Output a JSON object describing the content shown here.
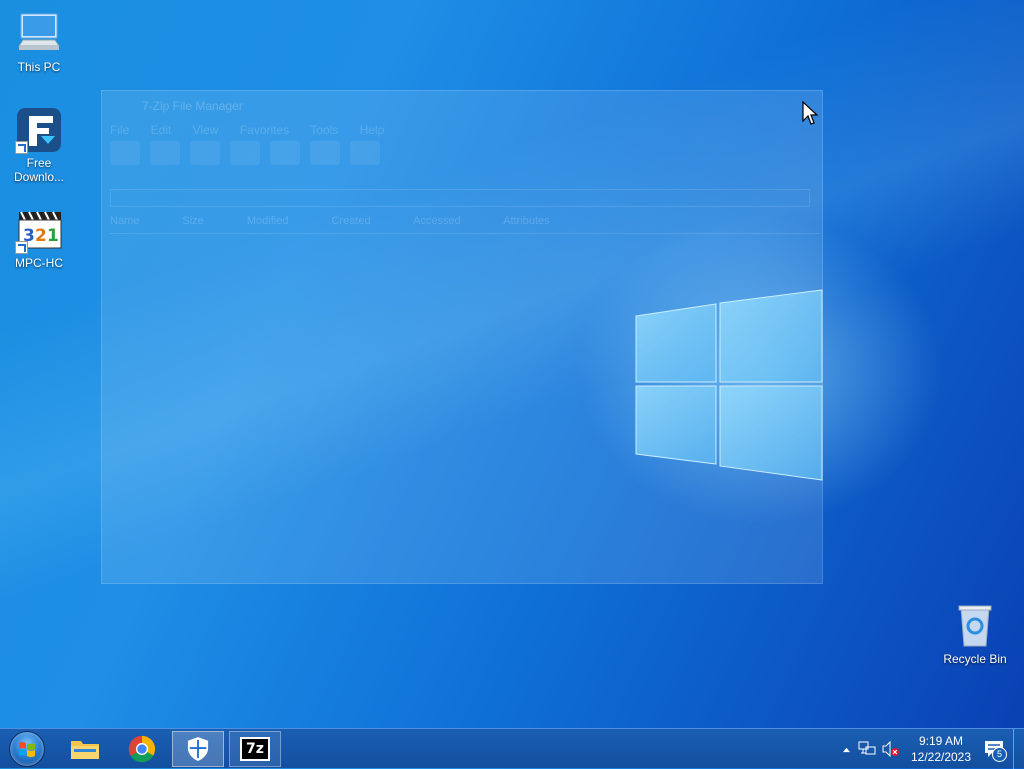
{
  "desktop": {
    "icons": [
      {
        "label": "This PC",
        "icon": "this-pc-icon"
      },
      {
        "label": "Free Downlo...",
        "icon": "free-download-manager-icon"
      },
      {
        "label": "MPC-HC",
        "icon": "mpc-hc-icon"
      },
      {
        "label": "Recycle Bin",
        "icon": "recycle-bin-icon"
      }
    ]
  },
  "ghost_window": {
    "title": "7-Zip File Manager",
    "menu": "File Edit View Favorites Tools Help",
    "path": "",
    "columns": "Name Size Modified Created Accessed Attributes",
    "row": "",
    "status": ""
  },
  "taskbar": {
    "start": "start-orb",
    "pinned": [
      {
        "name": "file-explorer",
        "icon": "folder-icon"
      },
      {
        "name": "chrome",
        "icon": "chrome-icon"
      },
      {
        "name": "windows-security",
        "icon": "shield-icon",
        "state": "active"
      },
      {
        "name": "7-zip",
        "icon": "7zip-icon",
        "label": "7z",
        "state": "running"
      }
    ],
    "tray": {
      "time": "9:19 AM",
      "date": "12/22/2023",
      "notifications": "5"
    }
  },
  "colors": {
    "taskbar": "#1a5fb3",
    "desktop_blue": "#1a8fe0"
  }
}
